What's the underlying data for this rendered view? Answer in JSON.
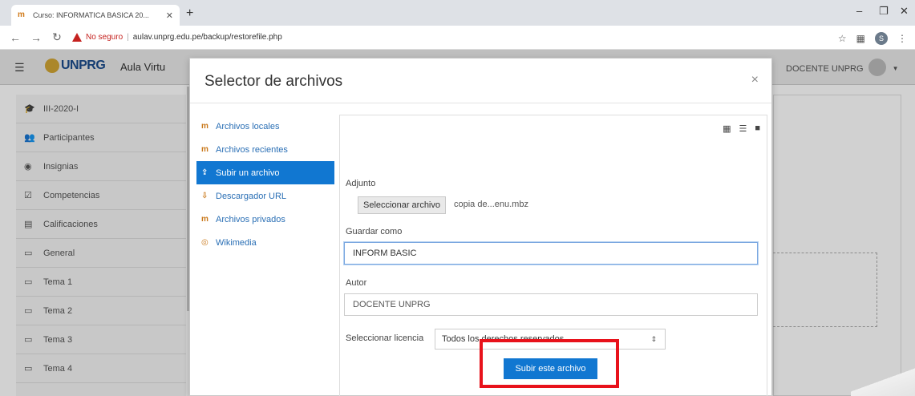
{
  "browser": {
    "tab_title": "Curso: INFORMATICA BASICA 20...",
    "favicon": "moodle-icon",
    "security_warning": "No seguro",
    "url": "aulav.unprg.edu.pe/backup/restorefile.php",
    "profile_initial": "S"
  },
  "navbar": {
    "logo_text": "UNPRG",
    "site_name": "Aula Virtu",
    "user_name": "DOCENTE UNPRG"
  },
  "drawer": {
    "items": [
      {
        "icon": "graduation-cap-icon",
        "label": "III-2020-I"
      },
      {
        "icon": "users-icon",
        "label": "Participantes"
      },
      {
        "icon": "badge-icon",
        "label": "Insignias"
      },
      {
        "icon": "checkbox-icon",
        "label": "Competencias"
      },
      {
        "icon": "table-icon",
        "label": "Calificaciones"
      },
      {
        "icon": "folder-icon",
        "label": "General"
      },
      {
        "icon": "folder-icon",
        "label": "Tema 1"
      },
      {
        "icon": "folder-icon",
        "label": "Tema 2"
      },
      {
        "icon": "folder-icon",
        "label": "Tema 3"
      },
      {
        "icon": "folder-icon",
        "label": "Tema 4"
      }
    ]
  },
  "modal": {
    "title": "Selector de archivos",
    "repositories": [
      {
        "label": "Archivos locales",
        "active": false
      },
      {
        "label": "Archivos recientes",
        "active": false
      },
      {
        "label": "Subir un archivo",
        "active": true
      },
      {
        "label": "Descargador URL",
        "active": false
      },
      {
        "label": "Archivos privados",
        "active": false
      },
      {
        "label": "Wikimedia",
        "active": false
      }
    ],
    "form": {
      "attachment_label": "Adjunto",
      "choose_button": "Seleccionar archivo",
      "chosen_file": "copia de...enu.mbz",
      "save_as_label": "Guardar como",
      "save_as_value": "INFORM BASIC",
      "author_label": "Autor",
      "author_value": "DOCENTE UNPRG",
      "license_label": "Seleccionar licencia",
      "license_value": "Todos los derechos reservados",
      "upload_button": "Subir este archivo"
    }
  },
  "colors": {
    "primary": "#1177d1",
    "highlight": "#e8121b",
    "warning": "#c5221f"
  }
}
